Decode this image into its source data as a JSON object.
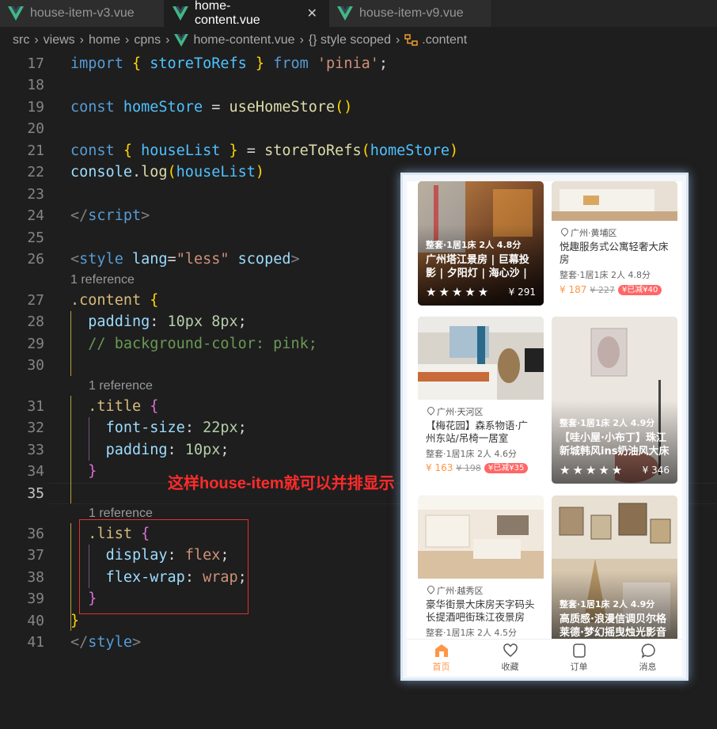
{
  "tabs": [
    {
      "label": "house-item-v3.vue",
      "active": false
    },
    {
      "label": "home-content.vue",
      "active": true,
      "close": "✕"
    },
    {
      "label": "house-item-v9.vue",
      "active": false
    }
  ],
  "breadcrumb": {
    "items": [
      "src",
      "views",
      "home",
      "cpns",
      "home-content.vue",
      "{} style scoped",
      ".content"
    ]
  },
  "line_numbers": [
    "17",
    "18",
    "19",
    "20",
    "21",
    "22",
    "23",
    "24",
    "25",
    "26",
    "27",
    "28",
    "29",
    "30",
    "31",
    "32",
    "33",
    "34",
    "35",
    "36",
    "37",
    "38",
    "39",
    "40",
    "41"
  ],
  "codelens": {
    "reference": "1 reference"
  },
  "code": {
    "l17": {
      "k1": "import",
      "b1": "{",
      "id": "storeToRefs",
      "b2": "}",
      "k2": "from",
      "s": "'pinia'",
      "p": ";"
    },
    "l19": {
      "k": "const",
      "v": "homeStore",
      "eq": "=",
      "fn": "useHomeStore",
      "par": "()"
    },
    "l21": {
      "k": "const",
      "b1": "{",
      "v": "houseList",
      "b2": "}",
      "eq": "=",
      "fn": "storeToRefs",
      "p1": "(",
      "a": "homeStore",
      "p2": ")"
    },
    "l22": {
      "obj": "console",
      "dot": ".",
      "fn": "log",
      "p1": "(",
      "a": "houseList",
      "p2": ")"
    },
    "l24": {
      "open": "</",
      "tag": "script",
      "close": ">"
    },
    "l26": {
      "open": "<",
      "tag": "style",
      "a1": "lang",
      "eq": "=",
      "s": "\"less\"",
      "a2": "scoped",
      "close": ">"
    },
    "l27": {
      "sel": ".content",
      "b": "{"
    },
    "l28": {
      "prop": "padding",
      "c": ":",
      "v": "10px 8px",
      "semi": ";"
    },
    "l29": {
      "cmt": "// background-color: pink;"
    },
    "l31": {
      "sel": ".title",
      "b": "{"
    },
    "l32": {
      "prop": "font-size",
      "c": ":",
      "v": "22px",
      "semi": ";"
    },
    "l33": {
      "prop": "padding",
      "c": ":",
      "v": "10px",
      "semi": ";"
    },
    "l34": {
      "b": "}"
    },
    "l36": {
      "sel": ".list",
      "b": "{"
    },
    "l37": {
      "prop": "display",
      "c": ":",
      "v": "flex",
      "semi": ";"
    },
    "l38": {
      "prop": "flex-wrap",
      "c": ":",
      "v": "wrap",
      "semi": ";"
    },
    "l39": {
      "b": "}"
    },
    "l40": {
      "b": "}"
    },
    "l41": {
      "open": "</",
      "tag": "style",
      "close": ">"
    }
  },
  "annotation": "这样house-item就可以并排显示",
  "phone": {
    "cards": [
      {
        "summary": "整套·1居1床 2人 4.8分",
        "name": "广州塔江景房 | 巨幕投影 | 夕阳灯 | 海心沙 | 珠江新城",
        "stars": "★★★★★",
        "price": "¥ 291"
      },
      {
        "location": "广州·黄埔区",
        "name": "悦趣服务式公寓轻奢大床房",
        "summary": "整套·1居1床 2人 4.8分",
        "price": "¥ 187",
        "old_price": "¥ 227",
        "badge": "¥已减¥40"
      },
      {
        "location": "广州·天河区",
        "name": "【梅花园】森系物语·广州东站/吊椅一居室",
        "summary": "整套·1居1床 2人 4.6分",
        "price": "¥ 163",
        "old_price": "¥ 198",
        "badge": "¥已减¥35"
      },
      {
        "summary": "整套·1居1床 2人 4.9分",
        "name": "【哇小屋·小布丁】珠江新城韩风ins奶油风大床房",
        "stars": "★★★★★",
        "price": "¥ 346"
      },
      {
        "location": "广州·越秀区",
        "name": "豪华街景大床房天字码头长提酒吧街珠江夜景房",
        "summary": "整套·1居1床 2人 4.5分"
      },
      {
        "summary": "整套·1居1床 2人 4.9分",
        "name": "高质感·浪漫信调贝尔格莱德·梦幻摇曳烛光影音房"
      }
    ],
    "tabbar": [
      {
        "label": "首页",
        "icon": "home-icon",
        "active": true
      },
      {
        "label": "收藏",
        "icon": "heart-icon",
        "active": false
      },
      {
        "label": "订单",
        "icon": "order-icon",
        "active": false
      },
      {
        "label": "消息",
        "icon": "message-icon",
        "active": false
      }
    ],
    "colors": {
      "accent": "#ff9645",
      "badge": "#ff6666"
    }
  }
}
